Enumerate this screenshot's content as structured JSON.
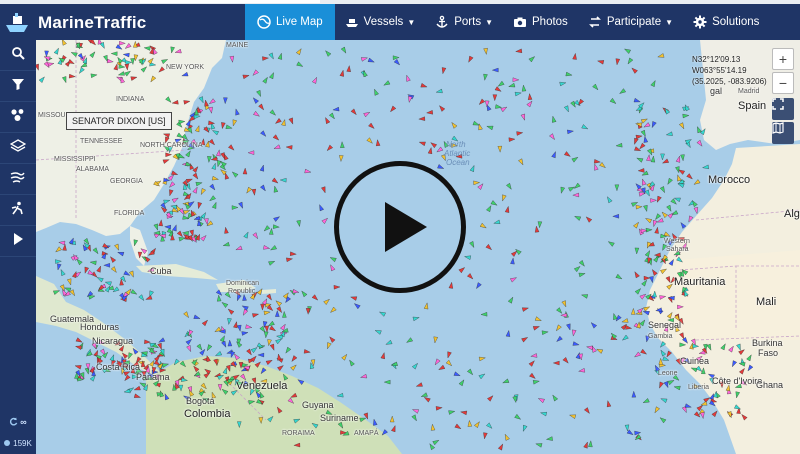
{
  "app": {
    "name": "MarineTraffic"
  },
  "nav": {
    "items": [
      {
        "label": "Live Map",
        "icon": "globe-icon",
        "active": true,
        "dropdown": false
      },
      {
        "label": "Vessels",
        "icon": "ship-icon",
        "active": false,
        "dropdown": true
      },
      {
        "label": "Ports",
        "icon": "anchor-icon",
        "active": false,
        "dropdown": true
      },
      {
        "label": "Photos",
        "icon": "camera-icon",
        "active": false,
        "dropdown": false
      },
      {
        "label": "Participate",
        "icon": "share-icon",
        "active": false,
        "dropdown": true
      },
      {
        "label": "Solutions",
        "icon": "gear-icon",
        "active": false,
        "dropdown": false
      }
    ]
  },
  "sidebar": {
    "tools": [
      "search-icon",
      "filter-icon",
      "fleet-icon",
      "layers-icon",
      "weather-icon",
      "routes-icon",
      "play-icon"
    ],
    "live_label": "∞",
    "vessel_count": "159K"
  },
  "map": {
    "tooltip": "SENATOR DIXON [US]",
    "coords": {
      "lat": "N32°12'09.13",
      "lon": "W063°55'14.19",
      "decimal": "(35.2025, -083.9206)"
    },
    "zoom_in": "+",
    "zoom_out": "−",
    "labels": {
      "maine": "MAINE",
      "new_york": "NEW YORK",
      "missouri": "MISSOURI",
      "indiana": "INDIANA",
      "tennessee": "TENNESSEE",
      "north_carolina": "NORTH CAROLINA",
      "mississippi": "MISSISSIPPI",
      "alabama": "ALABAMA",
      "georgia": "GEORGIA",
      "florida": "FLORIDA",
      "cuba": "Cuba",
      "dominican": "Dominican",
      "republic": "Republic",
      "guatemala": "Guatemala",
      "honduras": "Honduras",
      "nicaragua": "Nicaragua",
      "costa_rica": "Costa Rica",
      "panama": "Panama",
      "venezuela": "Venezuela",
      "bogota": "Bogotá",
      "colombia": "Colombia",
      "guyana": "Guyana",
      "suriname": "Suriname",
      "roraima": "RORAIMA",
      "amapa": "AMAPÁ",
      "north_atlantic": "North",
      "atlantic2": "Atlantic",
      "ocean": "Ocean",
      "spain": "Spain",
      "madrid": "Madrid",
      "portugal": "gal",
      "morocco": "Morocco",
      "algeria": "Alge",
      "western": "Western",
      "sahara": "Sahara",
      "mauritania": "Mauritania",
      "mali": "Mali",
      "senegal": "Senegal",
      "gambia": "Gambia",
      "guinea": "Guinea",
      "burkina": "Burkina",
      "faso": "Faso",
      "cote": "Côte d'Ivoire",
      "ghana": "Ghana",
      "leone": "Leone",
      "liberia": "Liberia"
    }
  },
  "colors": {
    "header": "#1f3566",
    "active_tab": "#1a8fd8",
    "ocean": "#a8cde8",
    "land": "#f1ede4",
    "vessel_cargo": "#3fd16b",
    "vessel_tanker": "#e23a3a",
    "vessel_passenger": "#3b5bff",
    "vessel_other": "#ff66d9"
  }
}
